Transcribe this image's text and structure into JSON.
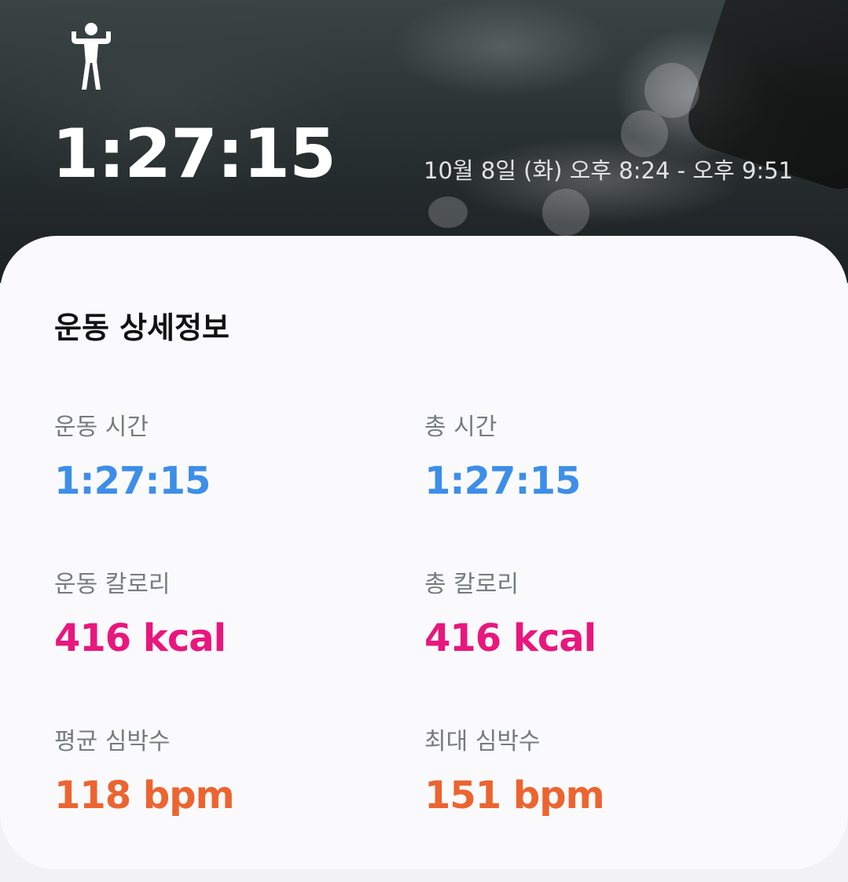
{
  "header": {
    "icon": "strength-workout-icon",
    "elapsed": "1:27:15",
    "time_range": "10월 8일 (화) 오후 8:24 - 오후 9:51"
  },
  "details": {
    "title": "운동 상세정보",
    "stats": [
      {
        "label": "운동 시간",
        "value": "1:27:15",
        "color": "#3d8ee8"
      },
      {
        "label": "총 시간",
        "value": "1:27:15",
        "color": "#3d8ee8"
      },
      {
        "label": "운동 칼로리",
        "value": "416 kcal",
        "color": "#e8177e"
      },
      {
        "label": "총 칼로리",
        "value": "416 kcal",
        "color": "#e8177e"
      },
      {
        "label": "평균 심박수",
        "value": "118 bpm",
        "color": "#ec6430"
      },
      {
        "label": "최대 심박수",
        "value": "151 bpm",
        "color": "#ec6430"
      }
    ]
  }
}
